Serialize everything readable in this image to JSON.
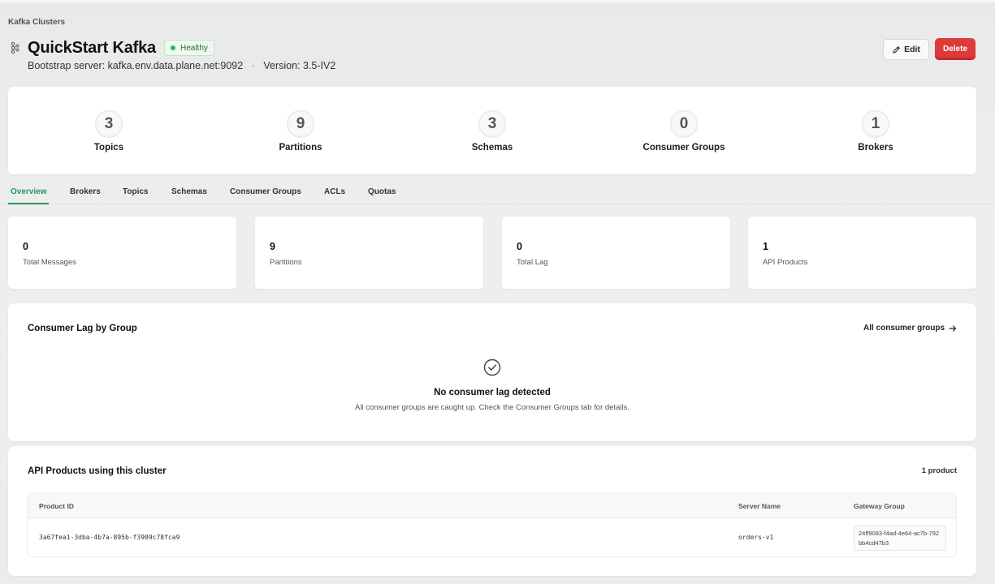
{
  "breadcrumb": "Kafka Clusters",
  "cluster": {
    "title": "QuickStart Kafka",
    "status": "Healthy",
    "status_color": "#2fb35a",
    "bootstrap": "Bootstrap server: kafka.env.data.plane.net:9092",
    "separator": "·",
    "version": "Version: 3.5-IV2"
  },
  "actions": {
    "edit": "Edit",
    "delete": "Delete",
    "delete_color": "#de3a3a"
  },
  "stats": [
    {
      "value": "3",
      "label": "Topics"
    },
    {
      "value": "9",
      "label": "Partitions"
    },
    {
      "value": "3",
      "label": "Schemas"
    },
    {
      "value": "0",
      "label": "Consumer Groups"
    },
    {
      "value": "1",
      "label": "Brokers"
    }
  ],
  "tabs": [
    {
      "label": "Overview",
      "active": true
    },
    {
      "label": "Brokers"
    },
    {
      "label": "Topics"
    },
    {
      "label": "Schemas"
    },
    {
      "label": "Consumer Groups"
    },
    {
      "label": "ACLs"
    },
    {
      "label": "Quotas"
    }
  ],
  "accent_color": "#1f9a5a",
  "metrics": [
    {
      "value": "0",
      "label": "Total Messages"
    },
    {
      "value": "9",
      "label": "Partitions"
    },
    {
      "value": "0",
      "label": "Total Lag"
    },
    {
      "value": "1",
      "label": "API Products"
    }
  ],
  "lag": {
    "title": "Consumer Lag by Group",
    "link": "All consumer groups",
    "link_icon": "arrow-right-icon",
    "empty_icon": "check-circle-icon",
    "empty_title": "No consumer lag detected",
    "empty_text": "All consumer groups are caught up. Check the Consumer Groups tab for details."
  },
  "products": {
    "title": "API Products using this cluster",
    "count": "1 product",
    "columns": [
      "Product ID",
      "Server Name",
      "Gateway Group"
    ],
    "rows": [
      {
        "product_id": "3a67fea1-3dba-4b7a-895b-f3909c78fca9",
        "server_name": "orders-v1",
        "gateway_group": "24ff9083-f4ad-4e64-ac7b-792bb4cd47b3"
      }
    ]
  }
}
